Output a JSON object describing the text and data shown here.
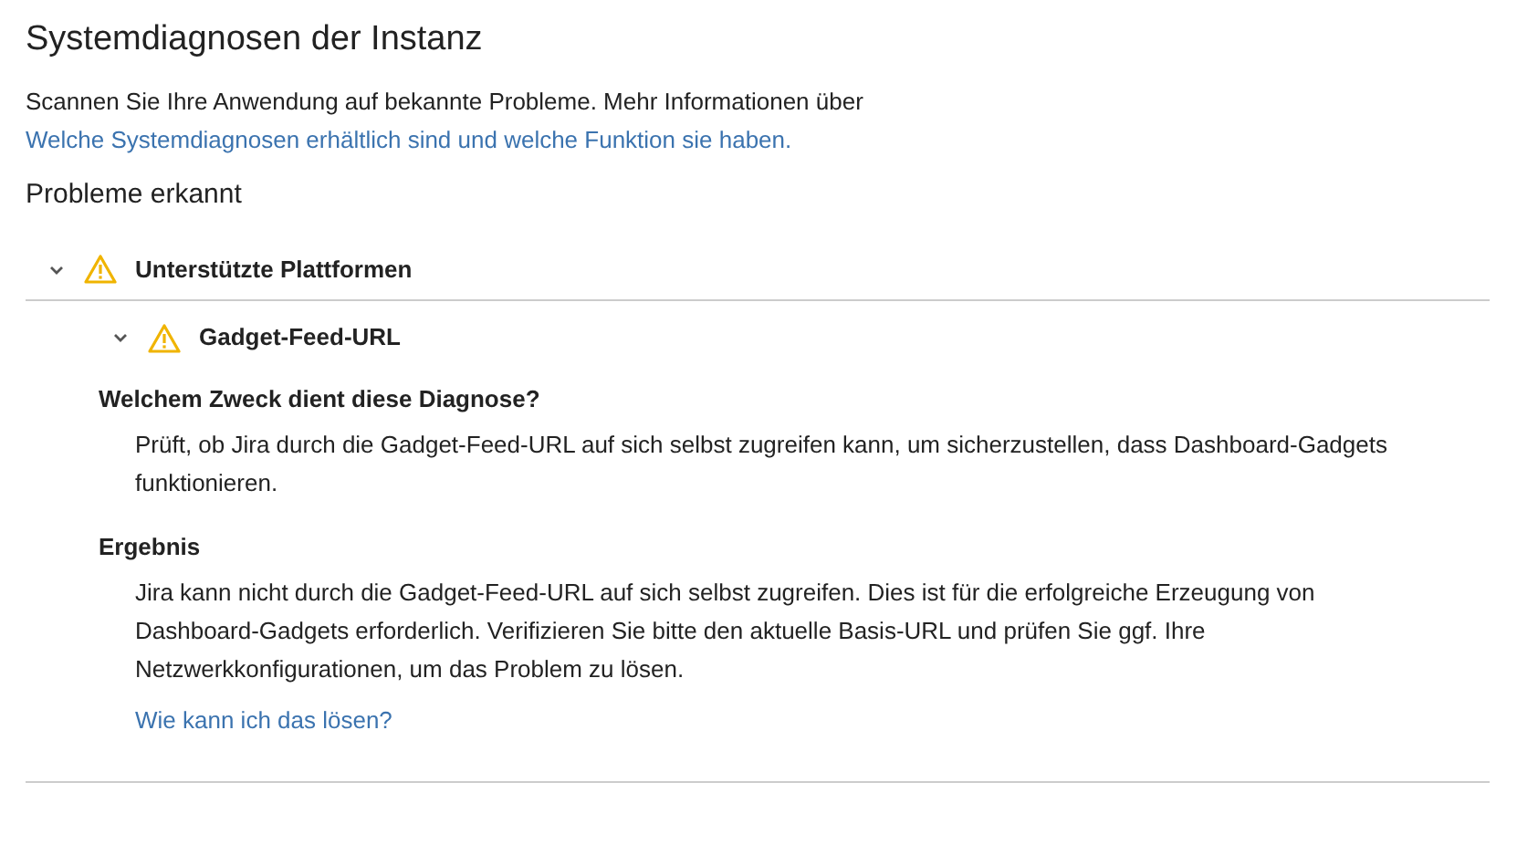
{
  "page": {
    "title": "Systemdiagnosen der Instanz",
    "intro": "Scannen Sie Ihre Anwendung auf bekannte Probleme. Mehr Informationen über",
    "intro_link": "Welche Systemdiagnosen erhältlich sind und welche Funktion sie haben."
  },
  "section_title": "Probleme erkannt",
  "checks": [
    {
      "name": "Unterstützte Plattformen",
      "expanded": true,
      "kind": "warning",
      "children": [
        {
          "name": "Gadget-Feed-URL",
          "expanded": true,
          "kind": "warning",
          "details": [
            {
              "heading": "Welchem Zweck dient diese Diagnose?",
              "text": "Prüft, ob Jira durch die Gadget-Feed-URL auf sich selbst zugreifen kann, um sicherzustellen, dass Dashboard-Gadgets funktionieren."
            },
            {
              "heading": "Ergebnis",
              "text": "Jira kann nicht durch die Gadget-Feed-URL auf sich selbst zugreifen. Dies ist für die erfolgreiche Erzeugung von Dashboard-Gadgets erforderlich. Verifizieren Sie bitte den aktuelle Basis-URL und prüfen Sie ggf. Ihre Netzwerkkonfigurationen, um das Problem zu lösen.",
              "link": "Wie kann ich das lösen?"
            }
          ]
        }
      ]
    }
  ]
}
